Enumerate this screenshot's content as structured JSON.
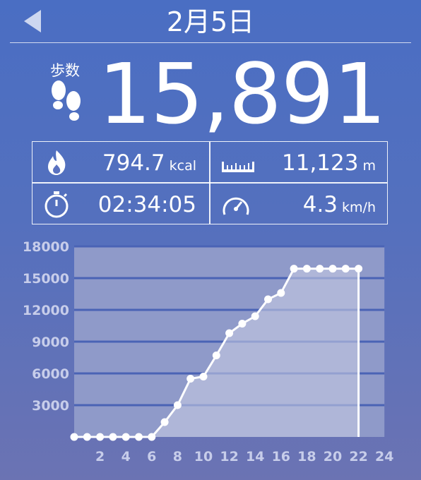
{
  "header": {
    "date": "2月5日"
  },
  "steps": {
    "label": "歩数",
    "value": "15,891"
  },
  "stats": {
    "calories": {
      "value": "794.7",
      "unit": "kcal"
    },
    "distance": {
      "value": "11,123",
      "unit": "m"
    },
    "duration": {
      "value": "02:34:05"
    },
    "speed": {
      "value": "4.3",
      "unit": "km/h"
    }
  },
  "chart_data": {
    "type": "area",
    "y_ticks": [
      "18000",
      "15000",
      "12000",
      "9000",
      "6000",
      "3000"
    ],
    "x_ticks": [
      "2",
      "4",
      "6",
      "8",
      "10",
      "12",
      "14",
      "16",
      "18",
      "20",
      "22",
      "24"
    ],
    "ylim": [
      0,
      18000
    ],
    "xlim": [
      0,
      24
    ],
    "x": [
      0,
      1,
      2,
      3,
      4,
      5,
      6,
      7,
      8,
      9,
      10,
      11,
      12,
      13,
      14,
      15,
      16,
      17,
      18,
      19,
      20,
      21,
      22
    ],
    "values": [
      0,
      0,
      0,
      0,
      0,
      0,
      0,
      1400,
      3000,
      5500,
      5700,
      7700,
      9800,
      10700,
      11400,
      13000,
      13600,
      15891,
      15891,
      15891,
      15891,
      15891,
      15891
    ],
    "colors": {
      "line": "#ffffff",
      "grid": "#4a63b5",
      "plot_bg": "#8f9ac9",
      "area": "#c4c9e2",
      "tick": "#c7cdea"
    }
  }
}
